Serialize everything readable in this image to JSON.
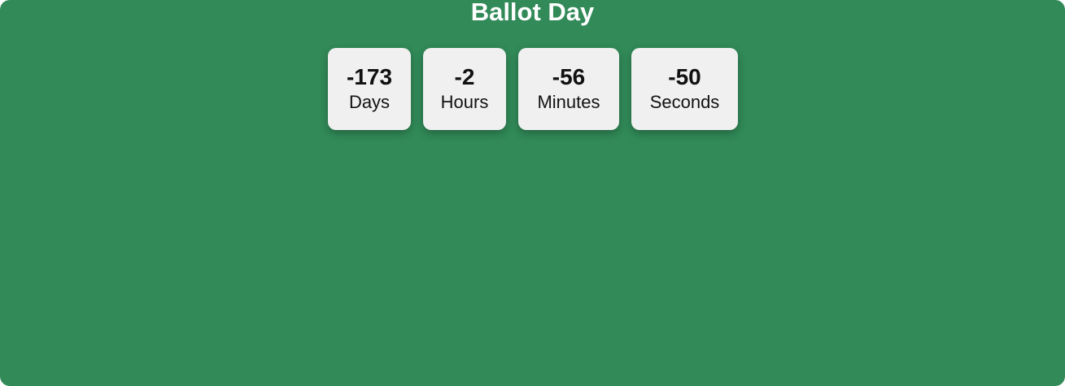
{
  "header": {
    "title": "Ballot Day"
  },
  "countdown": {
    "days": {
      "value": "-173",
      "label": "Days"
    },
    "hours": {
      "value": "-2",
      "label": "Hours"
    },
    "minutes": {
      "value": "-56",
      "label": "Minutes"
    },
    "seconds": {
      "value": "-50",
      "label": "Seconds"
    }
  },
  "colors": {
    "background": "#318a58",
    "card": "#f0f0f0",
    "title_text": "#ffffff",
    "card_text": "#111111"
  }
}
